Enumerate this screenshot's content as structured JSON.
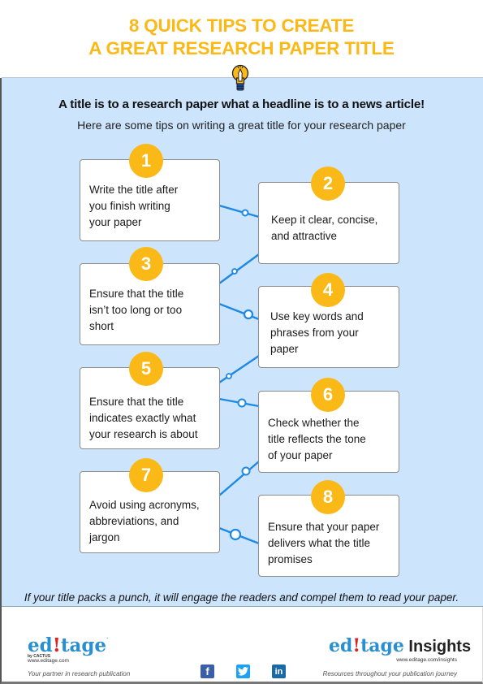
{
  "header": {
    "title_line1": "8 QUICK TIPS TO CREATE",
    "title_line2": "A GREAT RESEARCH PAPER TITLE",
    "icon": "lightbulb-icon",
    "title_color": "#fbb917"
  },
  "intro": {
    "headline": "A title is to a research paper what a headline is to a news article!",
    "subheadline": "Here are some tips on writing a great title for your research paper"
  },
  "tips": [
    {
      "number": "1",
      "text_lines": [
        "Write the title after",
        "you finish writing",
        "your paper"
      ]
    },
    {
      "number": "2",
      "text_lines": [
        "Keep it clear, concise,",
        "and attractive"
      ]
    },
    {
      "number": "3",
      "text_lines": [
        "Ensure that the title",
        "isn’t too long or too",
        "short"
      ]
    },
    {
      "number": "4",
      "text_lines": [
        "Use key words and",
        "phrases from your",
        "paper"
      ]
    },
    {
      "number": "5",
      "text_lines": [
        "Ensure that the title",
        "indicates exactly what",
        "your research is about"
      ]
    },
    {
      "number": "6",
      "text_lines": [
        "Check whether the",
        "title reflects the tone",
        "of your paper"
      ]
    },
    {
      "number": "7",
      "text_lines": [
        "Avoid using acronyms,",
        "abbreviations, and",
        "jargon"
      ]
    },
    {
      "number": "8",
      "text_lines": [
        "Ensure that your paper",
        "delivers what the title",
        "promises"
      ]
    }
  ],
  "closing": "If your title packs a punch, it will engage the readers and compel them to read your paper.",
  "footer": {
    "left_logo": {
      "pre": "ed",
      "pencil": "!",
      "post": "tage",
      "mark": ".",
      "by": "by CACTUS",
      "url": "www.editage.com",
      "tagline": "Your partner in research publication"
    },
    "right_logo": {
      "pre": "ed",
      "pencil": "!",
      "post": "tage",
      "suffix": " Insights",
      "url": "www.editage.com/insights",
      "tagline": "Resources throughout your publication journey"
    },
    "social": [
      {
        "name": "facebook-icon",
        "glyph": "f"
      },
      {
        "name": "twitter-icon",
        "glyph": "t"
      },
      {
        "name": "linkedin-icon",
        "glyph": "in"
      }
    ]
  },
  "colors": {
    "accent": "#fbb917",
    "background": "#cce4fc",
    "connector": "#1e88e5",
    "brand_blue": "#2a8fcf"
  }
}
